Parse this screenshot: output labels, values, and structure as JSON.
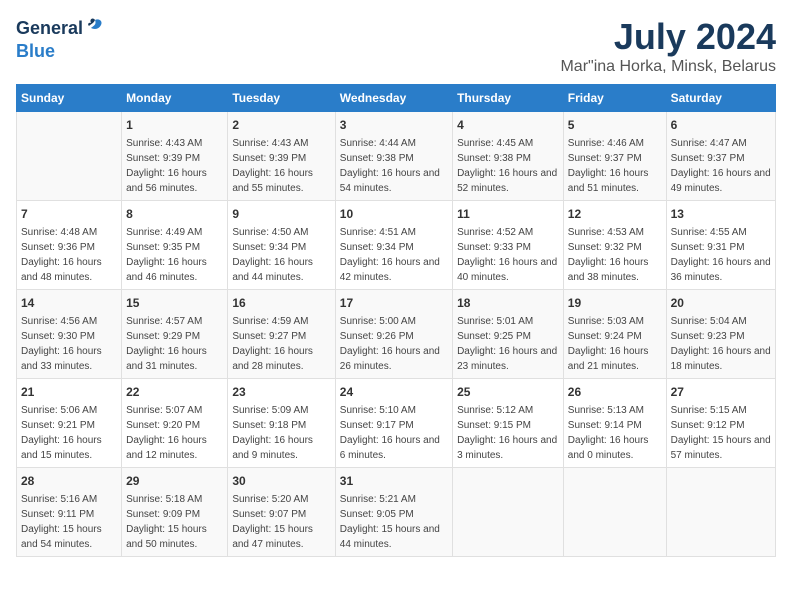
{
  "brand": {
    "name_general": "General",
    "name_blue": "Blue"
  },
  "title": "July 2024",
  "subtitle": "Mar\"ina Horka, Minsk, Belarus",
  "weekdays": [
    "Sunday",
    "Monday",
    "Tuesday",
    "Wednesday",
    "Thursday",
    "Friday",
    "Saturday"
  ],
  "weeks": [
    [
      {
        "day": "",
        "sunrise": "",
        "sunset": "",
        "daylight": ""
      },
      {
        "day": "1",
        "sunrise": "Sunrise: 4:43 AM",
        "sunset": "Sunset: 9:39 PM",
        "daylight": "Daylight: 16 hours and 56 minutes."
      },
      {
        "day": "2",
        "sunrise": "Sunrise: 4:43 AM",
        "sunset": "Sunset: 9:39 PM",
        "daylight": "Daylight: 16 hours and 55 minutes."
      },
      {
        "day": "3",
        "sunrise": "Sunrise: 4:44 AM",
        "sunset": "Sunset: 9:38 PM",
        "daylight": "Daylight: 16 hours and 54 minutes."
      },
      {
        "day": "4",
        "sunrise": "Sunrise: 4:45 AM",
        "sunset": "Sunset: 9:38 PM",
        "daylight": "Daylight: 16 hours and 52 minutes."
      },
      {
        "day": "5",
        "sunrise": "Sunrise: 4:46 AM",
        "sunset": "Sunset: 9:37 PM",
        "daylight": "Daylight: 16 hours and 51 minutes."
      },
      {
        "day": "6",
        "sunrise": "Sunrise: 4:47 AM",
        "sunset": "Sunset: 9:37 PM",
        "daylight": "Daylight: 16 hours and 49 minutes."
      }
    ],
    [
      {
        "day": "7",
        "sunrise": "Sunrise: 4:48 AM",
        "sunset": "Sunset: 9:36 PM",
        "daylight": "Daylight: 16 hours and 48 minutes."
      },
      {
        "day": "8",
        "sunrise": "Sunrise: 4:49 AM",
        "sunset": "Sunset: 9:35 PM",
        "daylight": "Daylight: 16 hours and 46 minutes."
      },
      {
        "day": "9",
        "sunrise": "Sunrise: 4:50 AM",
        "sunset": "Sunset: 9:34 PM",
        "daylight": "Daylight: 16 hours and 44 minutes."
      },
      {
        "day": "10",
        "sunrise": "Sunrise: 4:51 AM",
        "sunset": "Sunset: 9:34 PM",
        "daylight": "Daylight: 16 hours and 42 minutes."
      },
      {
        "day": "11",
        "sunrise": "Sunrise: 4:52 AM",
        "sunset": "Sunset: 9:33 PM",
        "daylight": "Daylight: 16 hours and 40 minutes."
      },
      {
        "day": "12",
        "sunrise": "Sunrise: 4:53 AM",
        "sunset": "Sunset: 9:32 PM",
        "daylight": "Daylight: 16 hours and 38 minutes."
      },
      {
        "day": "13",
        "sunrise": "Sunrise: 4:55 AM",
        "sunset": "Sunset: 9:31 PM",
        "daylight": "Daylight: 16 hours and 36 minutes."
      }
    ],
    [
      {
        "day": "14",
        "sunrise": "Sunrise: 4:56 AM",
        "sunset": "Sunset: 9:30 PM",
        "daylight": "Daylight: 16 hours and 33 minutes."
      },
      {
        "day": "15",
        "sunrise": "Sunrise: 4:57 AM",
        "sunset": "Sunset: 9:29 PM",
        "daylight": "Daylight: 16 hours and 31 minutes."
      },
      {
        "day": "16",
        "sunrise": "Sunrise: 4:59 AM",
        "sunset": "Sunset: 9:27 PM",
        "daylight": "Daylight: 16 hours and 28 minutes."
      },
      {
        "day": "17",
        "sunrise": "Sunrise: 5:00 AM",
        "sunset": "Sunset: 9:26 PM",
        "daylight": "Daylight: 16 hours and 26 minutes."
      },
      {
        "day": "18",
        "sunrise": "Sunrise: 5:01 AM",
        "sunset": "Sunset: 9:25 PM",
        "daylight": "Daylight: 16 hours and 23 minutes."
      },
      {
        "day": "19",
        "sunrise": "Sunrise: 5:03 AM",
        "sunset": "Sunset: 9:24 PM",
        "daylight": "Daylight: 16 hours and 21 minutes."
      },
      {
        "day": "20",
        "sunrise": "Sunrise: 5:04 AM",
        "sunset": "Sunset: 9:23 PM",
        "daylight": "Daylight: 16 hours and 18 minutes."
      }
    ],
    [
      {
        "day": "21",
        "sunrise": "Sunrise: 5:06 AM",
        "sunset": "Sunset: 9:21 PM",
        "daylight": "Daylight: 16 hours and 15 minutes."
      },
      {
        "day": "22",
        "sunrise": "Sunrise: 5:07 AM",
        "sunset": "Sunset: 9:20 PM",
        "daylight": "Daylight: 16 hours and 12 minutes."
      },
      {
        "day": "23",
        "sunrise": "Sunrise: 5:09 AM",
        "sunset": "Sunset: 9:18 PM",
        "daylight": "Daylight: 16 hours and 9 minutes."
      },
      {
        "day": "24",
        "sunrise": "Sunrise: 5:10 AM",
        "sunset": "Sunset: 9:17 PM",
        "daylight": "Daylight: 16 hours and 6 minutes."
      },
      {
        "day": "25",
        "sunrise": "Sunrise: 5:12 AM",
        "sunset": "Sunset: 9:15 PM",
        "daylight": "Daylight: 16 hours and 3 minutes."
      },
      {
        "day": "26",
        "sunrise": "Sunrise: 5:13 AM",
        "sunset": "Sunset: 9:14 PM",
        "daylight": "Daylight: 16 hours and 0 minutes."
      },
      {
        "day": "27",
        "sunrise": "Sunrise: 5:15 AM",
        "sunset": "Sunset: 9:12 PM",
        "daylight": "Daylight: 15 hours and 57 minutes."
      }
    ],
    [
      {
        "day": "28",
        "sunrise": "Sunrise: 5:16 AM",
        "sunset": "Sunset: 9:11 PM",
        "daylight": "Daylight: 15 hours and 54 minutes."
      },
      {
        "day": "29",
        "sunrise": "Sunrise: 5:18 AM",
        "sunset": "Sunset: 9:09 PM",
        "daylight": "Daylight: 15 hours and 50 minutes."
      },
      {
        "day": "30",
        "sunrise": "Sunrise: 5:20 AM",
        "sunset": "Sunset: 9:07 PM",
        "daylight": "Daylight: 15 hours and 47 minutes."
      },
      {
        "day": "31",
        "sunrise": "Sunrise: 5:21 AM",
        "sunset": "Sunset: 9:05 PM",
        "daylight": "Daylight: 15 hours and 44 minutes."
      },
      {
        "day": "",
        "sunrise": "",
        "sunset": "",
        "daylight": ""
      },
      {
        "day": "",
        "sunrise": "",
        "sunset": "",
        "daylight": ""
      },
      {
        "day": "",
        "sunrise": "",
        "sunset": "",
        "daylight": ""
      }
    ]
  ]
}
